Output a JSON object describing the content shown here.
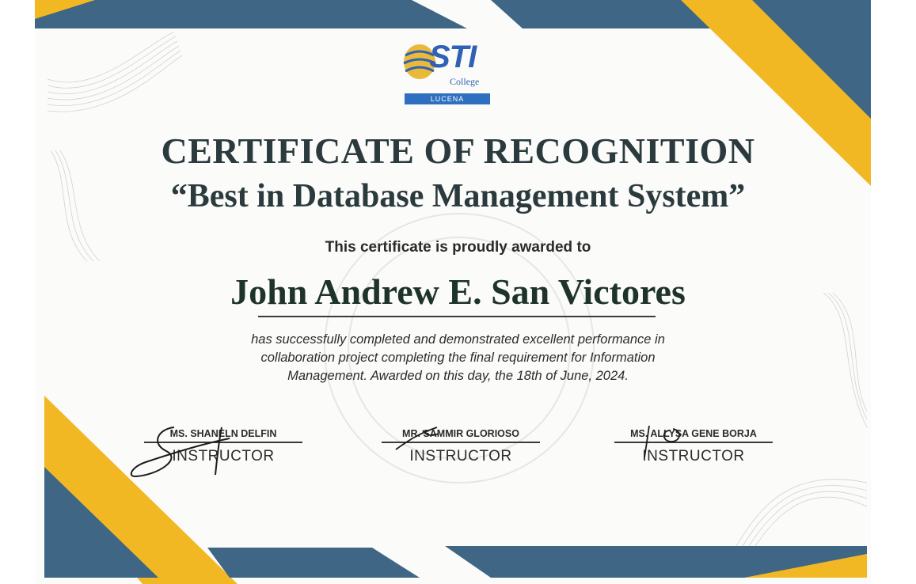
{
  "logo": {
    "wordmark": "STI",
    "subtext": "College",
    "campus": "LUCENA"
  },
  "certificate": {
    "title": "CERTIFICATE OF RECOGNITION",
    "award": "“Best in Database Management System”",
    "awarded_to_text": "This certificate is proudly awarded to",
    "recipient": "John Andrew E. San Victores",
    "body_lines": [
      "has successfully completed and demonstrated excellent performance in",
      "collaboration project completing the final requirement for Information",
      "Management. Awarded on this day, the 18th of June, 2024."
    ]
  },
  "signatories": [
    {
      "name": "MS. SHANELN DELFIN",
      "role": "INSTRUCTOR"
    },
    {
      "name": "MR. SAMMIR GLORIOSO",
      "role": "INSTRUCTOR"
    },
    {
      "name": "MS. ALLYSA GENE BORJA",
      "role": "INSTRUCTOR"
    }
  ],
  "colors": {
    "accent_yellow": "#f2b824",
    "accent_blue": "#3f6685",
    "text_dark": "#2a3a3d"
  }
}
